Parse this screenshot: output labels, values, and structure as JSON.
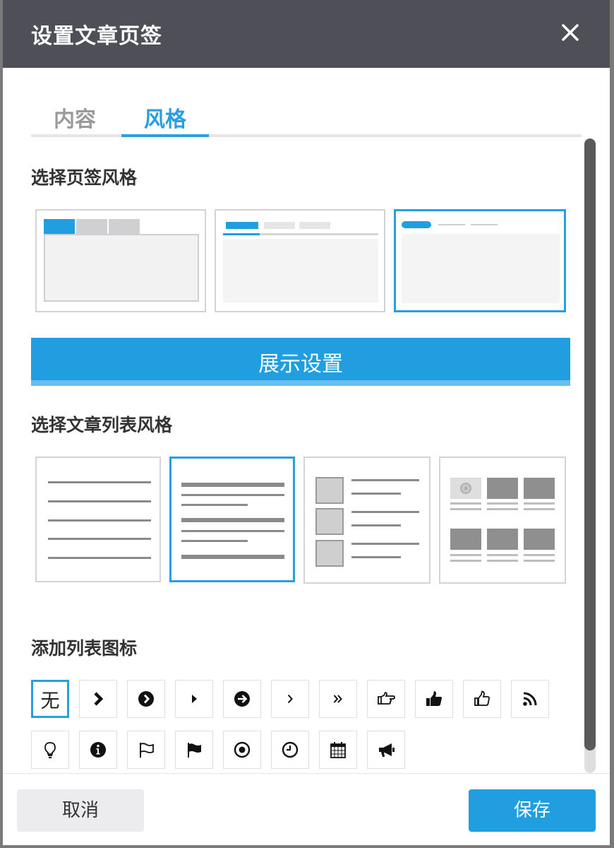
{
  "dialog": {
    "title": "设置文章页签"
  },
  "tabs": [
    {
      "label": "内容",
      "active": false
    },
    {
      "label": "风格",
      "active": true
    }
  ],
  "tab_style_section": {
    "title": "选择页签风格",
    "options": [
      {
        "name": "boxed-tabs",
        "selected": false
      },
      {
        "name": "underline-tabs",
        "selected": false
      },
      {
        "name": "pill-tabs",
        "selected": true
      }
    ]
  },
  "display_settings_button": {
    "label": "展示设置"
  },
  "list_style_section": {
    "title": "选择文章列表风格",
    "options": [
      {
        "name": "text-lines",
        "selected": false
      },
      {
        "name": "title-summary",
        "selected": true
      },
      {
        "name": "thumbnail-list",
        "selected": false
      },
      {
        "name": "image-grid",
        "selected": false
      }
    ]
  },
  "list_icon_section": {
    "title": "添加列表图标",
    "none_label": "无",
    "icons": [
      "none",
      "chevron-right-bold-icon",
      "circle-chevron-right-icon",
      "caret-right-icon",
      "circle-arrow-right-icon",
      "angle-right-icon",
      "double-angle-right-icon",
      "hand-pointing-right-icon",
      "thumbs-up-solid-icon",
      "thumbs-up-outline-icon",
      "rss-icon",
      "lightbulb-icon",
      "info-circle-icon",
      "flag-outline-icon",
      "flag-solid-icon",
      "dot-circle-icon",
      "clock-icon",
      "calendar-icon",
      "bullhorn-icon"
    ],
    "selected": "none"
  },
  "footer": {
    "cancel_label": "取消",
    "save_label": "保存"
  },
  "colors": {
    "accent": "#219ee0",
    "header": "#4f5057"
  }
}
